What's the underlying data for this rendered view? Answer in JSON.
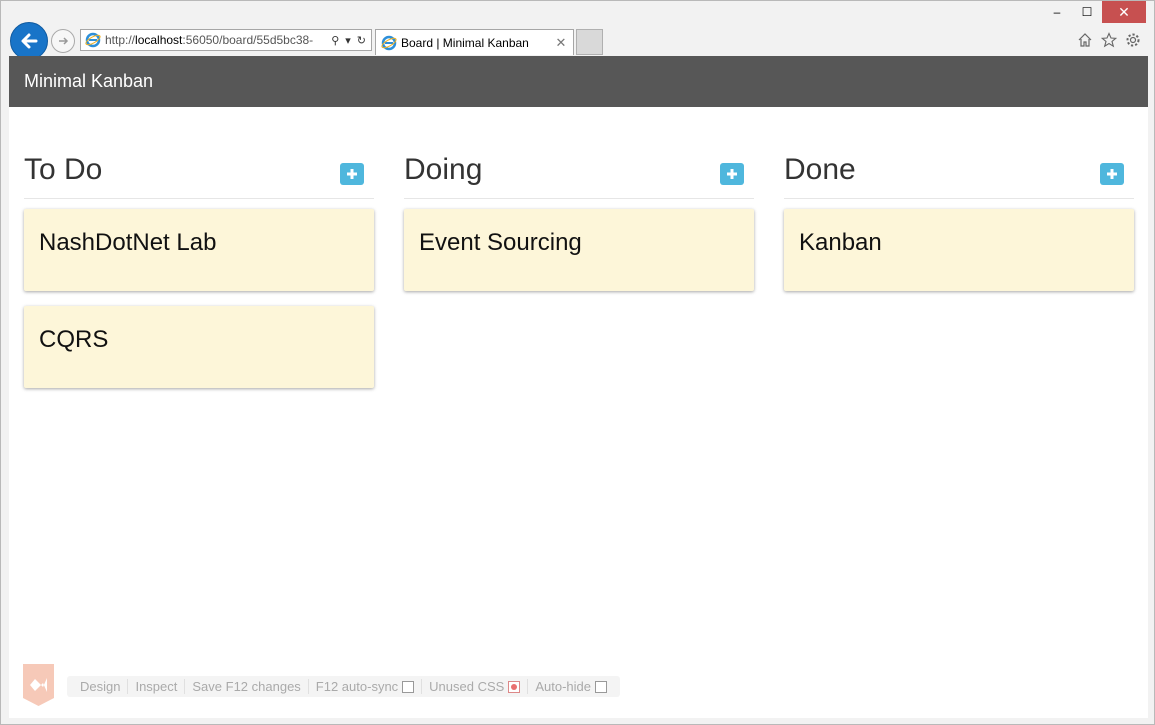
{
  "browser": {
    "url_prefix": "http://",
    "url_host": "localhost",
    "url_rest": ":56050/board/55d5bc38-",
    "tab_title": "Board | Minimal Kanban",
    "window_controls": [
      "minimize-icon",
      "maximize-icon",
      "close-icon"
    ],
    "toolbar_icons": [
      "home-icon",
      "star-icon",
      "gear-icon"
    ]
  },
  "app": {
    "title": "Minimal Kanban"
  },
  "board": {
    "columns": [
      {
        "title": "To Do",
        "cards": [
          "NashDotNet Lab",
          "CQRS"
        ]
      },
      {
        "title": "Doing",
        "cards": [
          "Event Sourcing"
        ]
      },
      {
        "title": "Done",
        "cards": [
          "Kanban"
        ]
      }
    ]
  },
  "browser_link": {
    "items": [
      "Design",
      "Inspect",
      "Save F12 changes",
      "F12 auto-sync",
      "Unused CSS",
      "Auto-hide"
    ]
  },
  "colors": {
    "navbar": "#575757",
    "card": "#fdf6d9",
    "add_button": "#4fb7dd",
    "close_button": "#c75050"
  }
}
